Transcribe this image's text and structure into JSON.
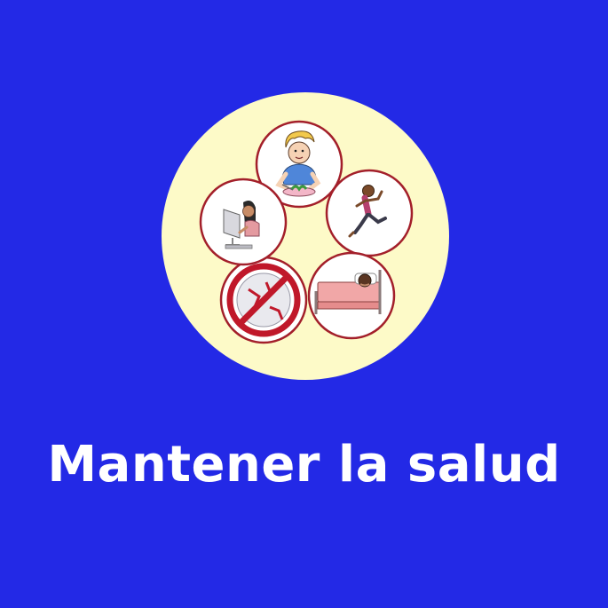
{
  "title": "Mantener la salud",
  "colors": {
    "background": "#2329e6",
    "disc": "#fdfac8",
    "ring_border": "#a31f2a",
    "prohibition": "#c0182a",
    "title_text": "#ffffff"
  },
  "pictograms": [
    {
      "name": "eating-healthy-icon"
    },
    {
      "name": "running-exercise-icon"
    },
    {
      "name": "sleeping-in-bed-icon"
    },
    {
      "name": "no-drugs-prohibition-icon"
    },
    {
      "name": "computer-use-icon"
    }
  ]
}
